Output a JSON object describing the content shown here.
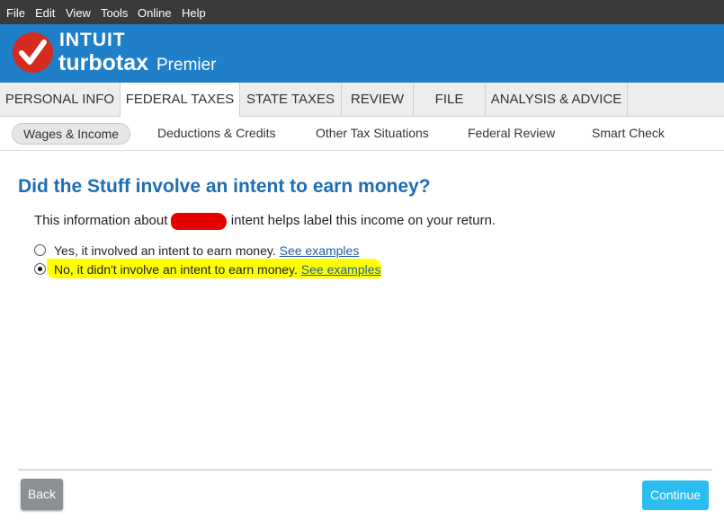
{
  "menu": [
    "File",
    "Edit",
    "View",
    "Tools",
    "Online",
    "Help"
  ],
  "brand": {
    "intuit": "INTUIT",
    "product": "turbotax",
    "edition": "Premier",
    "colors": {
      "header": "#1f7fc9",
      "logo": "#d52b1e"
    }
  },
  "tabs": [
    {
      "label": "PERSONAL INFO",
      "active": false
    },
    {
      "label": "FEDERAL TAXES",
      "active": true
    },
    {
      "label": "STATE TAXES",
      "active": false
    },
    {
      "label": "REVIEW",
      "active": false
    },
    {
      "label": "FILE",
      "active": false
    },
    {
      "label": "ANALYSIS & ADVICE",
      "active": false
    }
  ],
  "subtabs": [
    {
      "label": "Wages & Income",
      "active": true
    },
    {
      "label": "Deductions & Credits",
      "active": false
    },
    {
      "label": "Other Tax Situations",
      "active": false
    },
    {
      "label": "Federal Review",
      "active": false
    },
    {
      "label": "Smart Check",
      "active": false
    }
  ],
  "main": {
    "heading": "Did the Stuff involve an intent to earn money?",
    "info_before": "This information about ",
    "info_after": " intent helps label this income on your return.",
    "options": [
      {
        "text": "Yes, it involved an intent to earn money.",
        "link": "See examples",
        "selected": false
      },
      {
        "text": "No, it didn't involve an intent to earn money.",
        "link": "See examples",
        "selected": true
      }
    ]
  },
  "footer": {
    "back": "Back",
    "continue": "Continue"
  }
}
